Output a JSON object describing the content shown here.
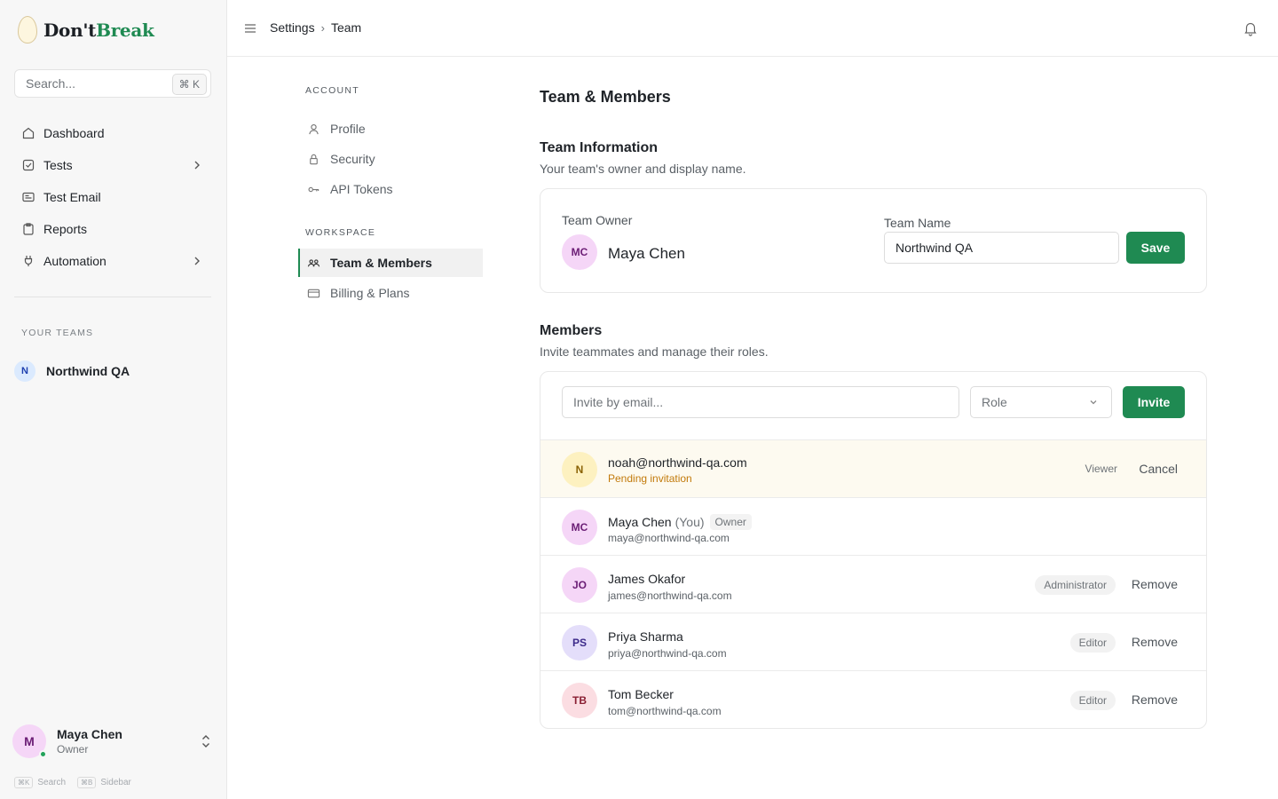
{
  "brand": {
    "name_part1": "Don't",
    "name_part2": "Break"
  },
  "sidebar": {
    "search_placeholder": "Search...",
    "search_shortcut": "⌘ K",
    "items": [
      {
        "label": "Dashboard",
        "icon": "home-icon",
        "has_children": false
      },
      {
        "label": "Tests",
        "icon": "checkbox-icon",
        "has_children": true
      },
      {
        "label": "Test Email",
        "icon": "mail-icon",
        "has_children": false
      },
      {
        "label": "Reports",
        "icon": "clipboard-icon",
        "has_children": false
      },
      {
        "label": "Automation",
        "icon": "plug-icon",
        "has_children": true
      }
    ],
    "teams_heading": "YOUR TEAMS",
    "team": {
      "initial": "N",
      "name": "Northwind QA"
    },
    "user": {
      "initial": "M",
      "name": "Maya Chen",
      "role": "Owner"
    },
    "shortcuts": [
      {
        "keys": "⌘K",
        "label": "Search"
      },
      {
        "keys": "⌘B",
        "label": "Sidebar"
      }
    ]
  },
  "topbar": {
    "breadcrumb": [
      "Settings",
      "Team"
    ]
  },
  "subnav": {
    "account_label": "ACCOUNT",
    "account_items": [
      {
        "label": "Profile",
        "icon": "user-icon"
      },
      {
        "label": "Security",
        "icon": "lock-icon"
      },
      {
        "label": "API Tokens",
        "icon": "key-icon"
      }
    ],
    "workspace_label": "WORKSPACE",
    "workspace_items": [
      {
        "label": "Team & Members",
        "icon": "users-icon",
        "active": true
      },
      {
        "label": "Billing & Plans",
        "icon": "credit-card-icon",
        "active": false
      }
    ]
  },
  "main": {
    "title": "Team & Members",
    "team_info": {
      "title": "Team Information",
      "subtitle": "Your team's owner and display name.",
      "owner_label": "Team Owner",
      "owner_initials": "MC",
      "owner_name": "Maya Chen",
      "team_name_label": "Team Name",
      "team_name_value": "Northwind QA",
      "save_label": "Save"
    },
    "members": {
      "title": "Members",
      "subtitle": "Invite teammates and manage their roles.",
      "invite_placeholder": "Invite by email...",
      "role_placeholder": "Role",
      "invite_label": "Invite",
      "pending": {
        "initials": "N",
        "email": "noah@northwind-qa.com",
        "status": "Pending invitation",
        "role": "Viewer",
        "action": "Cancel"
      },
      "list": [
        {
          "initials": "MC",
          "name": "Maya Chen",
          "you": "(You)",
          "tag": "Owner",
          "email": "maya@northwind-qa.com",
          "role": "",
          "action": "",
          "avatar_bg": "#f5d6f7",
          "avatar_fg": "#6b1d75"
        },
        {
          "initials": "JO",
          "name": "James Okafor",
          "you": "",
          "tag": "",
          "email": "james@northwind-qa.com",
          "role": "Administrator",
          "action": "Remove",
          "avatar_bg": "#f5d6f7",
          "avatar_fg": "#6b1d75"
        },
        {
          "initials": "PS",
          "name": "Priya Sharma",
          "you": "",
          "tag": "",
          "email": "priya@northwind-qa.com",
          "role": "Editor",
          "action": "Remove",
          "avatar_bg": "#e4defa",
          "avatar_fg": "#3c2a8a"
        },
        {
          "initials": "TB",
          "name": "Tom Becker",
          "you": "",
          "tag": "",
          "email": "tom@northwind-qa.com",
          "role": "Editor",
          "action": "Remove",
          "avatar_bg": "#fbdde2",
          "avatar_fg": "#8a1f33"
        }
      ]
    }
  },
  "colors": {
    "accent": "#1f8a52",
    "pending_text": "#c27a0b",
    "pending_bg": "#fdfaf0"
  }
}
